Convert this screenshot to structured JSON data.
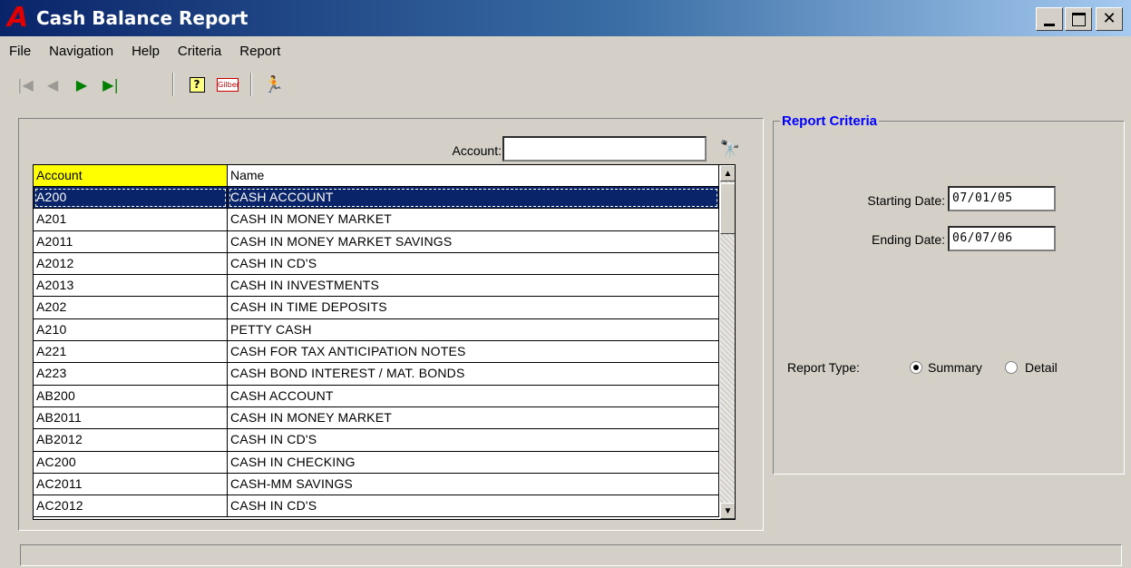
{
  "window": {
    "logo": "A",
    "title": "Cash Balance Report"
  },
  "menu": [
    "File",
    "Navigation",
    "Help",
    "Criteria",
    "Report"
  ],
  "toolbar": {
    "icons": [
      "first-record-icon",
      "previous-record-icon",
      "next-record-icon",
      "last-record-icon",
      "help-icon",
      "company-logo-icon",
      "run-report-icon"
    ],
    "help_glyph": "?",
    "logo_text": "Gilber"
  },
  "search": {
    "label": "Account:",
    "value": ""
  },
  "grid": {
    "columns": [
      "Account",
      "Name"
    ],
    "rows": [
      {
        "account": "A200",
        "name": "CASH ACCOUNT",
        "selected": true
      },
      {
        "account": "A201",
        "name": "CASH IN MONEY MARKET"
      },
      {
        "account": "A2011",
        "name": "CASH IN MONEY MARKET SAVINGS"
      },
      {
        "account": "A2012",
        "name": "CASH IN CD'S"
      },
      {
        "account": "A2013",
        "name": "CASH IN INVESTMENTS"
      },
      {
        "account": "A202",
        "name": "CASH IN TIME DEPOSITS"
      },
      {
        "account": "A210",
        "name": "PETTY CASH"
      },
      {
        "account": "A221",
        "name": "CASH FOR TAX ANTICIPATION NOTES"
      },
      {
        "account": "A223",
        "name": "CASH BOND INTEREST / MAT. BONDS"
      },
      {
        "account": "AB200",
        "name": "CASH ACCOUNT"
      },
      {
        "account": "AB2011",
        "name": "CASH IN MONEY MARKET"
      },
      {
        "account": "AB2012",
        "name": "CASH IN CD'S"
      },
      {
        "account": "AC200",
        "name": "CASH IN CHECKING"
      },
      {
        "account": "AC2011",
        "name": "CASH-MM SAVINGS"
      },
      {
        "account": "AC2012",
        "name": "CASH IN CD'S"
      }
    ]
  },
  "criteria": {
    "title": "Report Criteria",
    "starting_date_label": "Starting Date:",
    "starting_date": "07/01/05",
    "ending_date_label": "Ending Date:",
    "ending_date": "06/07/06",
    "report_type_label": "Report Type:",
    "report_type_options": [
      "Summary",
      "Detail"
    ],
    "report_type_selected": "Summary"
  },
  "status": {
    "text": ""
  },
  "colors": {
    "title_gradient_start": "#0a246a",
    "window_bg": "#d4d0c8",
    "selected_row": "#0a246a",
    "account_header": "#ffff00",
    "criteria_title": "#0000ff"
  }
}
